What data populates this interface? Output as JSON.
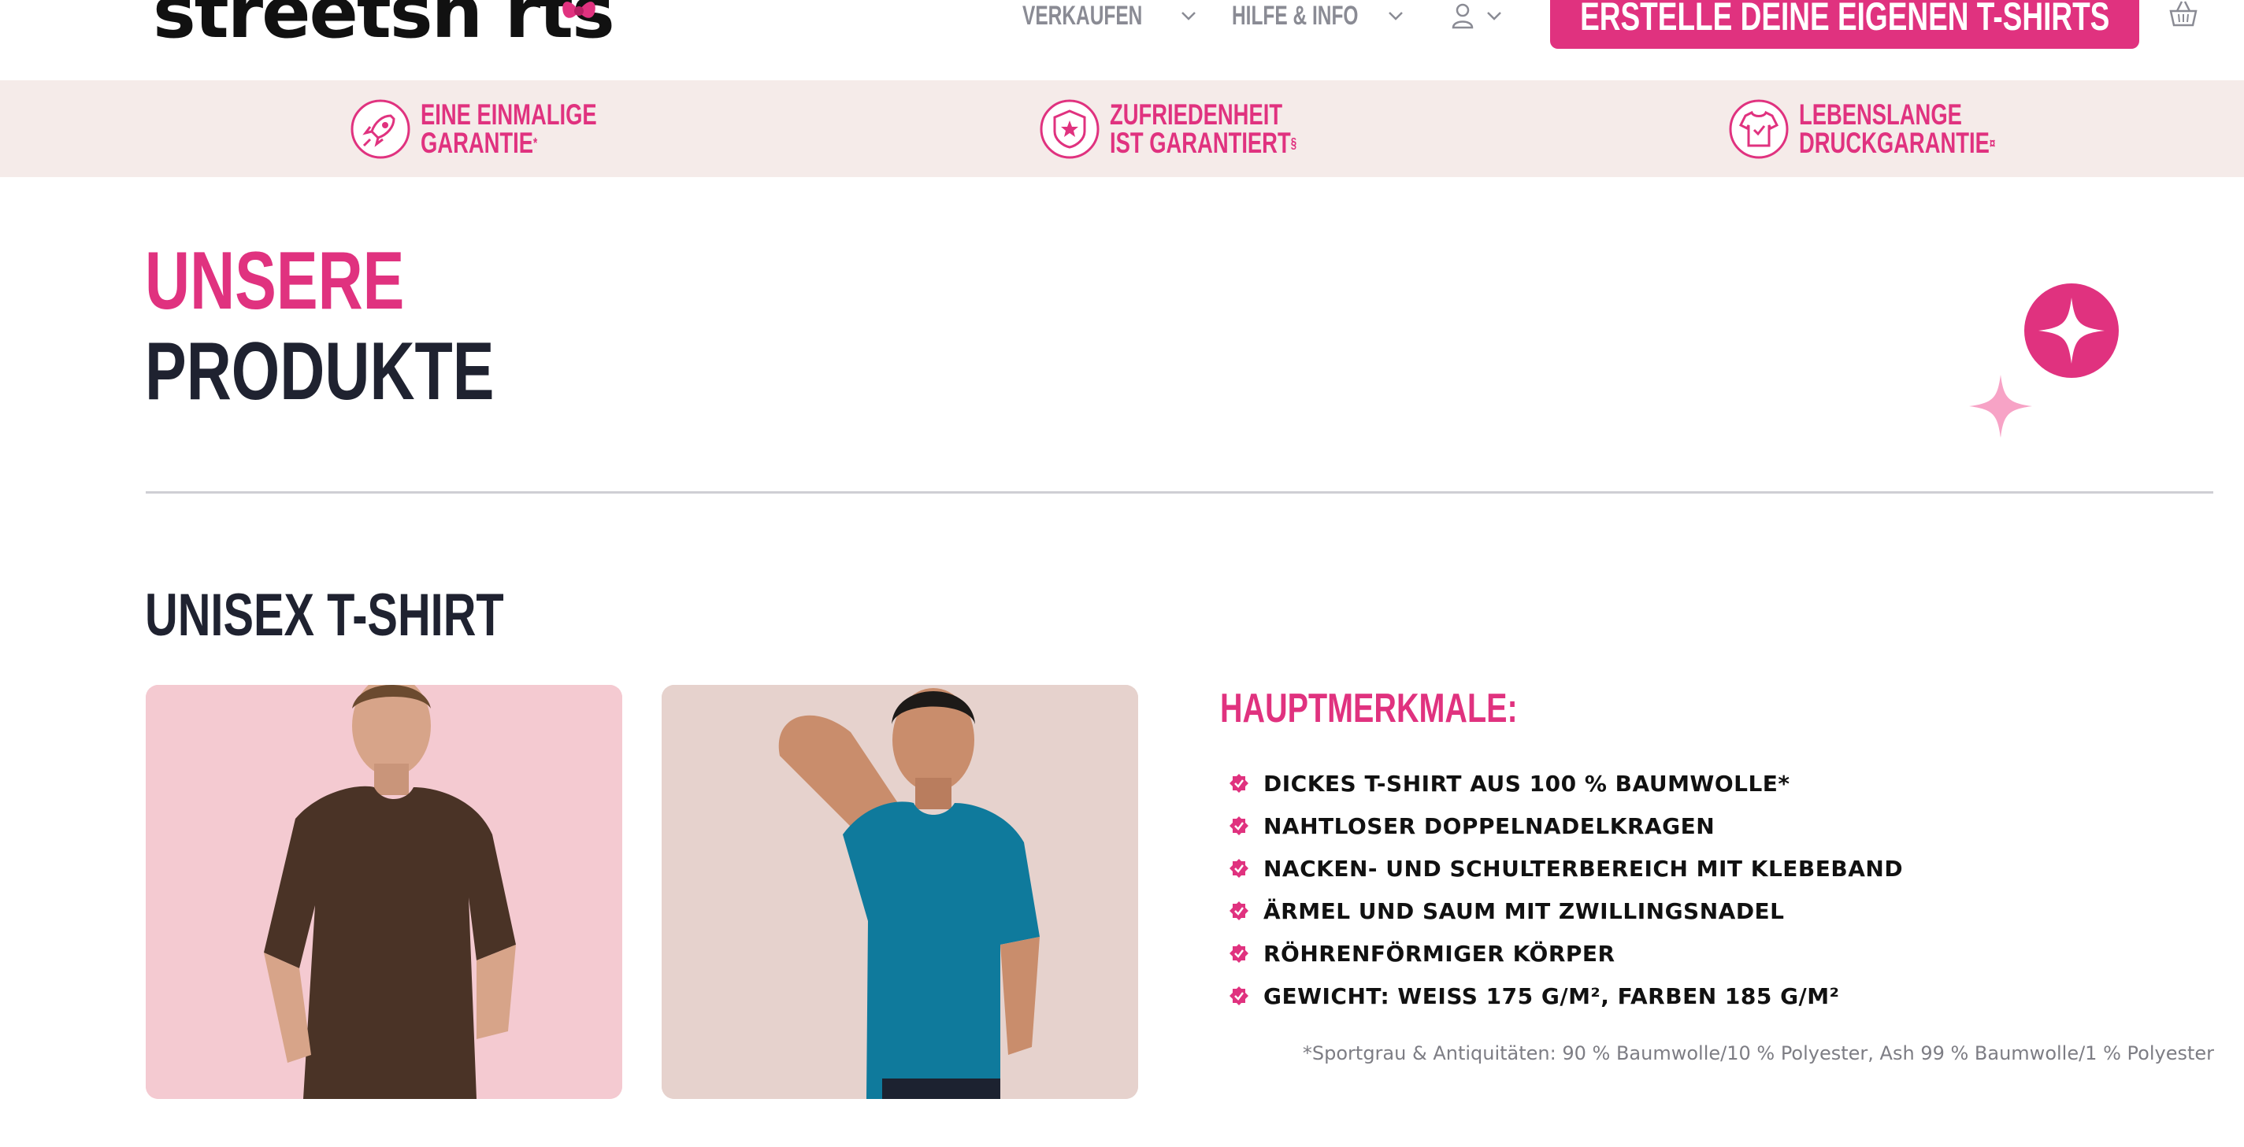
{
  "header": {
    "logo_text": "streetsh",
    "logo_tail": "rts",
    "nav": [
      {
        "label": "Verkaufen"
      },
      {
        "label": "Hilfe & Info"
      }
    ],
    "cta_label": "Erstelle deine eigenen T-Shirts"
  },
  "guarantees": [
    {
      "line1": "Eine einmalige",
      "line2": "Garantie",
      "mark": "*",
      "icon": "rocket-icon"
    },
    {
      "line1": "Zufriedenheit",
      "line2": "ist garantiert",
      "mark": "§",
      "icon": "star-badge-icon"
    },
    {
      "line1": "Lebenslange",
      "line2": "Druckgarantie",
      "mark": "¤",
      "icon": "shirt-icon"
    }
  ],
  "page": {
    "title_line1": "Unsere",
    "title_line2": "Produkte"
  },
  "product": {
    "name": "Unisex T-Shirt",
    "features_title": "Hauptmerkmale:",
    "features": [
      "Dickes T-Shirt aus 100 % Baumwolle*",
      "Nahtloser Doppelnadelkragen",
      "Nacken- und Schulterbereich mit Klebeband",
      "Ärmel und Saum mit Zwillingsnadel",
      "Röhrenförmiger Körper",
      "Gewicht: weiss 175 g/m², Farben 185 g/m²"
    ],
    "footnote": "*Sportgrau & Antiquitäten: 90 % Baumwolle/10 % Polyester, Ash 99 % Baumwolle/1 % Polyester",
    "photos": [
      {
        "shirt_color": "#4a3326",
        "background": "#f4cad1"
      },
      {
        "shirt_color": "#0f7a9c",
        "background": "#e6d2cd"
      }
    ]
  },
  "colors": {
    "accent": "#e0327f",
    "band": "#f5ebe9",
    "text": "#1f2230"
  }
}
